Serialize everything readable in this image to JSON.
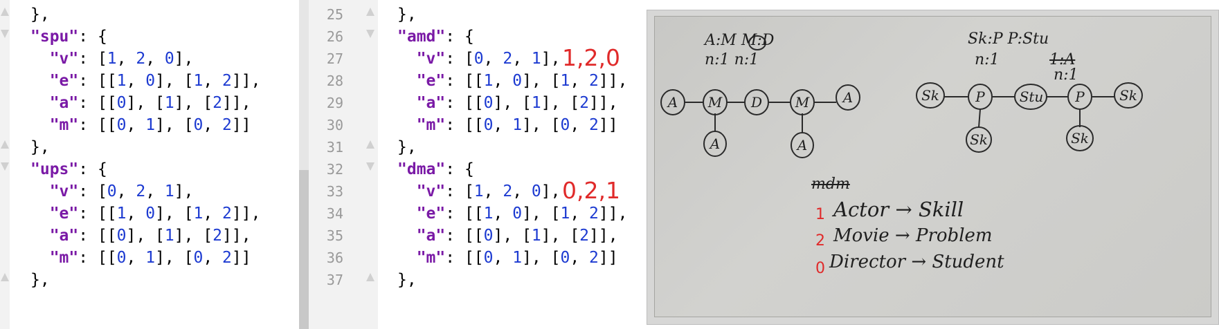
{
  "left_pane": {
    "lines": [
      {
        "fold": "up",
        "tokens": [
          {
            "t": "p",
            "v": "},"
          }
        ]
      },
      {
        "fold": "down",
        "tokens": [
          {
            "t": "k",
            "v": "\"spu\""
          },
          {
            "t": "p",
            "v": ": {"
          }
        ]
      },
      {
        "fold": "",
        "tokens": [
          {
            "t": "p",
            "v": "  "
          },
          {
            "t": "k",
            "v": "\"v\""
          },
          {
            "t": "p",
            "v": ": ["
          },
          {
            "t": "n",
            "v": "1"
          },
          {
            "t": "p",
            "v": ", "
          },
          {
            "t": "n",
            "v": "2"
          },
          {
            "t": "p",
            "v": ", "
          },
          {
            "t": "n",
            "v": "0"
          },
          {
            "t": "p",
            "v": "],"
          }
        ]
      },
      {
        "fold": "",
        "tokens": [
          {
            "t": "p",
            "v": "  "
          },
          {
            "t": "k",
            "v": "\"e\""
          },
          {
            "t": "p",
            "v": ": [["
          },
          {
            "t": "n",
            "v": "1"
          },
          {
            "t": "p",
            "v": ", "
          },
          {
            "t": "n",
            "v": "0"
          },
          {
            "t": "p",
            "v": "], ["
          },
          {
            "t": "n",
            "v": "1"
          },
          {
            "t": "p",
            "v": ", "
          },
          {
            "t": "n",
            "v": "2"
          },
          {
            "t": "p",
            "v": "]],"
          }
        ]
      },
      {
        "fold": "",
        "tokens": [
          {
            "t": "p",
            "v": "  "
          },
          {
            "t": "k",
            "v": "\"a\""
          },
          {
            "t": "p",
            "v": ": [["
          },
          {
            "t": "n",
            "v": "0"
          },
          {
            "t": "p",
            "v": "], ["
          },
          {
            "t": "n",
            "v": "1"
          },
          {
            "t": "p",
            "v": "], ["
          },
          {
            "t": "n",
            "v": "2"
          },
          {
            "t": "p",
            "v": "]],"
          }
        ]
      },
      {
        "fold": "",
        "tokens": [
          {
            "t": "p",
            "v": "  "
          },
          {
            "t": "k",
            "v": "\"m\""
          },
          {
            "t": "p",
            "v": ": [["
          },
          {
            "t": "n",
            "v": "0"
          },
          {
            "t": "p",
            "v": ", "
          },
          {
            "t": "n",
            "v": "1"
          },
          {
            "t": "p",
            "v": "], ["
          },
          {
            "t": "n",
            "v": "0"
          },
          {
            "t": "p",
            "v": ", "
          },
          {
            "t": "n",
            "v": "2"
          },
          {
            "t": "p",
            "v": "]]"
          }
        ]
      },
      {
        "fold": "up",
        "tokens": [
          {
            "t": "p",
            "v": "},"
          }
        ]
      },
      {
        "fold": "down",
        "tokens": [
          {
            "t": "k",
            "v": "\"ups\""
          },
          {
            "t": "p",
            "v": ": {"
          }
        ]
      },
      {
        "fold": "",
        "tokens": [
          {
            "t": "p",
            "v": "  "
          },
          {
            "t": "k",
            "v": "\"v\""
          },
          {
            "t": "p",
            "v": ": ["
          },
          {
            "t": "n",
            "v": "0"
          },
          {
            "t": "p",
            "v": ", "
          },
          {
            "t": "n",
            "v": "2"
          },
          {
            "t": "p",
            "v": ", "
          },
          {
            "t": "n",
            "v": "1"
          },
          {
            "t": "p",
            "v": "],"
          }
        ]
      },
      {
        "fold": "",
        "tokens": [
          {
            "t": "p",
            "v": "  "
          },
          {
            "t": "k",
            "v": "\"e\""
          },
          {
            "t": "p",
            "v": ": [["
          },
          {
            "t": "n",
            "v": "1"
          },
          {
            "t": "p",
            "v": ", "
          },
          {
            "t": "n",
            "v": "0"
          },
          {
            "t": "p",
            "v": "], ["
          },
          {
            "t": "n",
            "v": "1"
          },
          {
            "t": "p",
            "v": ", "
          },
          {
            "t": "n",
            "v": "2"
          },
          {
            "t": "p",
            "v": "]],"
          }
        ]
      },
      {
        "fold": "",
        "tokens": [
          {
            "t": "p",
            "v": "  "
          },
          {
            "t": "k",
            "v": "\"a\""
          },
          {
            "t": "p",
            "v": ": [["
          },
          {
            "t": "n",
            "v": "0"
          },
          {
            "t": "p",
            "v": "], ["
          },
          {
            "t": "n",
            "v": "1"
          },
          {
            "t": "p",
            "v": "], ["
          },
          {
            "t": "n",
            "v": "2"
          },
          {
            "t": "p",
            "v": "]],"
          }
        ]
      },
      {
        "fold": "",
        "tokens": [
          {
            "t": "p",
            "v": "  "
          },
          {
            "t": "k",
            "v": "\"m\""
          },
          {
            "t": "p",
            "v": ": [["
          },
          {
            "t": "n",
            "v": "0"
          },
          {
            "t": "p",
            "v": ", "
          },
          {
            "t": "n",
            "v": "1"
          },
          {
            "t": "p",
            "v": "], ["
          },
          {
            "t": "n",
            "v": "0"
          },
          {
            "t": "p",
            "v": ", "
          },
          {
            "t": "n",
            "v": "2"
          },
          {
            "t": "p",
            "v": "]]"
          }
        ]
      },
      {
        "fold": "up",
        "tokens": [
          {
            "t": "p",
            "v": "},"
          }
        ]
      }
    ]
  },
  "right_pane": {
    "lines": [
      {
        "no": "25",
        "fold": "up",
        "tokens": [
          {
            "t": "p",
            "v": "},"
          }
        ]
      },
      {
        "no": "26",
        "fold": "down",
        "tokens": [
          {
            "t": "k",
            "v": "\"amd\""
          },
          {
            "t": "p",
            "v": ": {"
          }
        ]
      },
      {
        "no": "27",
        "fold": "",
        "tokens": [
          {
            "t": "p",
            "v": "  "
          },
          {
            "t": "k",
            "v": "\"v\""
          },
          {
            "t": "p",
            "v": ": ["
          },
          {
            "t": "n",
            "v": "0"
          },
          {
            "t": "p",
            "v": ", "
          },
          {
            "t": "n",
            "v": "2"
          },
          {
            "t": "p",
            "v": ", "
          },
          {
            "t": "n",
            "v": "1"
          },
          {
            "t": "p",
            "v": "],"
          }
        ],
        "annotation": "1,2,0"
      },
      {
        "no": "28",
        "fold": "",
        "tokens": [
          {
            "t": "p",
            "v": "  "
          },
          {
            "t": "k",
            "v": "\"e\""
          },
          {
            "t": "p",
            "v": ": [["
          },
          {
            "t": "n",
            "v": "1"
          },
          {
            "t": "p",
            "v": ", "
          },
          {
            "t": "n",
            "v": "0"
          },
          {
            "t": "p",
            "v": "], ["
          },
          {
            "t": "n",
            "v": "1"
          },
          {
            "t": "p",
            "v": ", "
          },
          {
            "t": "n",
            "v": "2"
          },
          {
            "t": "p",
            "v": "]],"
          }
        ]
      },
      {
        "no": "29",
        "fold": "",
        "tokens": [
          {
            "t": "p",
            "v": "  "
          },
          {
            "t": "k",
            "v": "\"a\""
          },
          {
            "t": "p",
            "v": ": [["
          },
          {
            "t": "n",
            "v": "0"
          },
          {
            "t": "p",
            "v": "], ["
          },
          {
            "t": "n",
            "v": "1"
          },
          {
            "t": "p",
            "v": "], ["
          },
          {
            "t": "n",
            "v": "2"
          },
          {
            "t": "p",
            "v": "]],"
          }
        ]
      },
      {
        "no": "30",
        "fold": "",
        "tokens": [
          {
            "t": "p",
            "v": "  "
          },
          {
            "t": "k",
            "v": "\"m\""
          },
          {
            "t": "p",
            "v": ": [["
          },
          {
            "t": "n",
            "v": "0"
          },
          {
            "t": "p",
            "v": ", "
          },
          {
            "t": "n",
            "v": "1"
          },
          {
            "t": "p",
            "v": "], ["
          },
          {
            "t": "n",
            "v": "0"
          },
          {
            "t": "p",
            "v": ", "
          },
          {
            "t": "n",
            "v": "2"
          },
          {
            "t": "p",
            "v": "]]"
          }
        ]
      },
      {
        "no": "31",
        "fold": "up",
        "tokens": [
          {
            "t": "p",
            "v": "},"
          }
        ]
      },
      {
        "no": "32",
        "fold": "down",
        "tokens": [
          {
            "t": "k",
            "v": "\"dma\""
          },
          {
            "t": "p",
            "v": ": {"
          }
        ]
      },
      {
        "no": "33",
        "fold": "",
        "tokens": [
          {
            "t": "p",
            "v": "  "
          },
          {
            "t": "k",
            "v": "\"v\""
          },
          {
            "t": "p",
            "v": ": ["
          },
          {
            "t": "n",
            "v": "1"
          },
          {
            "t": "p",
            "v": ", "
          },
          {
            "t": "n",
            "v": "2"
          },
          {
            "t": "p",
            "v": ", "
          },
          {
            "t": "n",
            "v": "0"
          },
          {
            "t": "p",
            "v": "],"
          }
        ],
        "annotation": "0,2,1"
      },
      {
        "no": "34",
        "fold": "",
        "tokens": [
          {
            "t": "p",
            "v": "  "
          },
          {
            "t": "k",
            "v": "\"e\""
          },
          {
            "t": "p",
            "v": ": [["
          },
          {
            "t": "n",
            "v": "1"
          },
          {
            "t": "p",
            "v": ", "
          },
          {
            "t": "n",
            "v": "0"
          },
          {
            "t": "p",
            "v": "], ["
          },
          {
            "t": "n",
            "v": "1"
          },
          {
            "t": "p",
            "v": ", "
          },
          {
            "t": "n",
            "v": "2"
          },
          {
            "t": "p",
            "v": "]],"
          }
        ]
      },
      {
        "no": "35",
        "fold": "",
        "tokens": [
          {
            "t": "p",
            "v": "  "
          },
          {
            "t": "k",
            "v": "\"a\""
          },
          {
            "t": "p",
            "v": ": [["
          },
          {
            "t": "n",
            "v": "0"
          },
          {
            "t": "p",
            "v": "], ["
          },
          {
            "t": "n",
            "v": "1"
          },
          {
            "t": "p",
            "v": "], ["
          },
          {
            "t": "n",
            "v": "2"
          },
          {
            "t": "p",
            "v": "]],"
          }
        ]
      },
      {
        "no": "36",
        "fold": "",
        "tokens": [
          {
            "t": "p",
            "v": "  "
          },
          {
            "t": "k",
            "v": "\"m\""
          },
          {
            "t": "p",
            "v": ": [["
          },
          {
            "t": "n",
            "v": "0"
          },
          {
            "t": "p",
            "v": ", "
          },
          {
            "t": "n",
            "v": "1"
          },
          {
            "t": "p",
            "v": "], ["
          },
          {
            "t": "n",
            "v": "0"
          },
          {
            "t": "p",
            "v": ", "
          },
          {
            "t": "n",
            "v": "2"
          },
          {
            "t": "p",
            "v": "]]"
          }
        ]
      },
      {
        "no": "37",
        "fold": "up",
        "tokens": [
          {
            "t": "p",
            "v": "},"
          }
        ]
      }
    ]
  },
  "photo": {
    "left_header": {
      "line1": "A:M  M:D",
      "line2": "n:1   n:1"
    },
    "right_header": {
      "line1": "Sk:P   P:Stu",
      "line2": "n:1",
      "struck": "1:A",
      "line3": "n:1"
    },
    "left_graph_nodes": [
      "A",
      "M",
      "D",
      "M",
      "A",
      "A",
      "A"
    ],
    "right_graph_nodes": [
      "Sk",
      "P",
      "Stu",
      "P",
      "Sk",
      "Sk",
      "Sk"
    ],
    "struck_word": "mdm",
    "mapping": [
      {
        "num": "1",
        "text": "Actor → Skill"
      },
      {
        "num": "2",
        "text": "Movie → Problem"
      },
      {
        "num": "0",
        "text": "Director → Student"
      }
    ]
  },
  "colors": {
    "keyword": "#7a1aa6",
    "number": "#1c3ad1",
    "annotation": "#e02a2a"
  }
}
